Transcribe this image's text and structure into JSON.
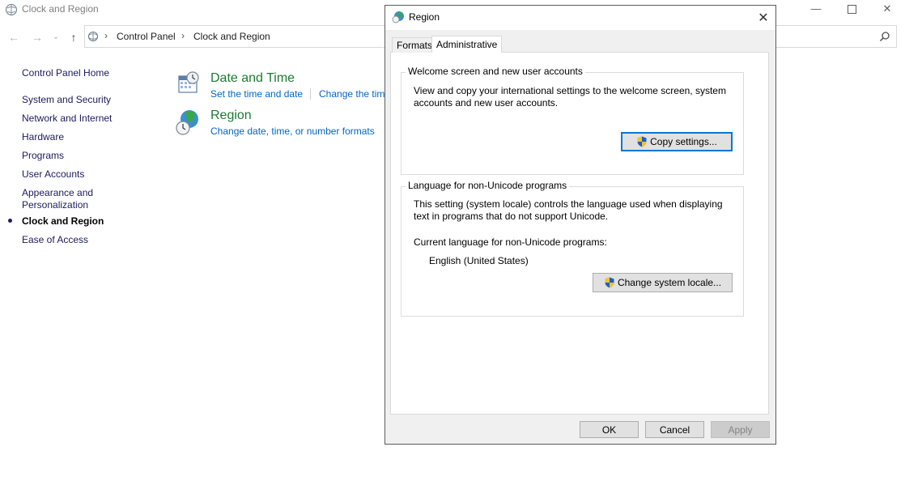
{
  "window": {
    "title": "Clock and Region",
    "minimize_glyph": "—",
    "close_glyph": "✕"
  },
  "nav": {
    "back_glyph": "←",
    "forward_glyph": "→",
    "recent_glyph": "⌄",
    "up_glyph": "↑",
    "breadcrumb": [
      "Control Panel",
      "Clock and Region"
    ],
    "separator": "›"
  },
  "sidebar": {
    "items": [
      {
        "label": "Control Panel Home"
      },
      {
        "label": "System and Security"
      },
      {
        "label": "Network and Internet"
      },
      {
        "label": "Hardware"
      },
      {
        "label": "Programs"
      },
      {
        "label": "User Accounts"
      },
      {
        "label": "Appearance and",
        "label2": "Personalization"
      },
      {
        "label": "Clock and Region",
        "active": true
      },
      {
        "label": "Ease of Access"
      }
    ]
  },
  "categories": [
    {
      "title": "Date and Time",
      "icon": "calendar-clock-icon",
      "links": [
        "Set the time and date",
        "Change the time zone"
      ]
    },
    {
      "title": "Region",
      "icon": "globe-clock-icon",
      "links": [
        "Change date, time, or number formats"
      ]
    }
  ],
  "dialog": {
    "title": "Region",
    "close_glyph": "✕",
    "tabs": [
      {
        "label": "Formats",
        "selected": false
      },
      {
        "label": "Administrative",
        "selected": true
      }
    ],
    "welcome_group": {
      "title": "Welcome screen and new user accounts",
      "text_line1": "View and copy your international settings to the welcome screen, system",
      "text_line2": "accounts and new user accounts.",
      "button": "Copy settings..."
    },
    "unicode_group": {
      "title": "Language for non-Unicode programs",
      "text_line1": "This setting (system locale) controls the language used when displaying",
      "text_line2": "text in programs that do not support Unicode.",
      "current_label": "Current language for non-Unicode programs:",
      "current_value": "English (United States)",
      "button": "Change system locale..."
    },
    "buttons": {
      "ok": "OK",
      "cancel": "Cancel",
      "apply": "Apply"
    }
  },
  "colors": {
    "category_title": "#1e7b31",
    "link": "#0066cc",
    "sidebar_link": "#1b1b5e",
    "focus_border": "#0078d7"
  }
}
